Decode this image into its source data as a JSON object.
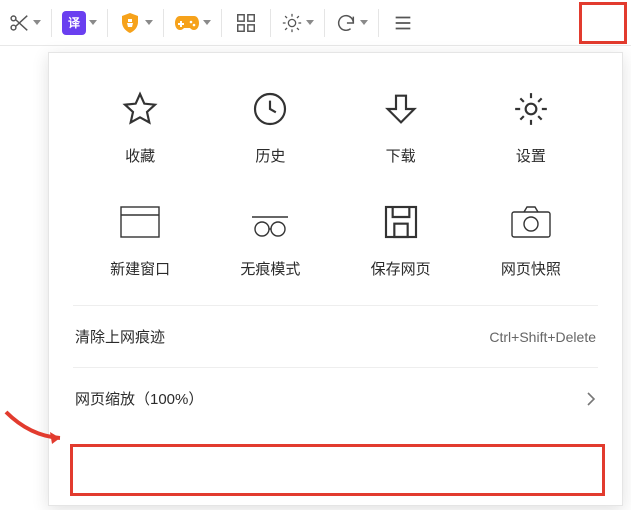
{
  "toolbar": {
    "translate_badge": "译"
  },
  "menu": {
    "grid": [
      {
        "id": "favorites",
        "label": "收藏"
      },
      {
        "id": "history",
        "label": "历史"
      },
      {
        "id": "downloads",
        "label": "下载"
      },
      {
        "id": "settings",
        "label": "设置"
      },
      {
        "id": "new-window",
        "label": "新建窗口"
      },
      {
        "id": "incognito",
        "label": "无痕模式"
      },
      {
        "id": "save-page",
        "label": "保存网页"
      },
      {
        "id": "snapshot",
        "label": "网页快照"
      }
    ],
    "clear_traces": {
      "label": "清除上网痕迹",
      "shortcut": "Ctrl+Shift+Delete"
    },
    "zoom": {
      "label": "网页缩放（100%）"
    }
  }
}
